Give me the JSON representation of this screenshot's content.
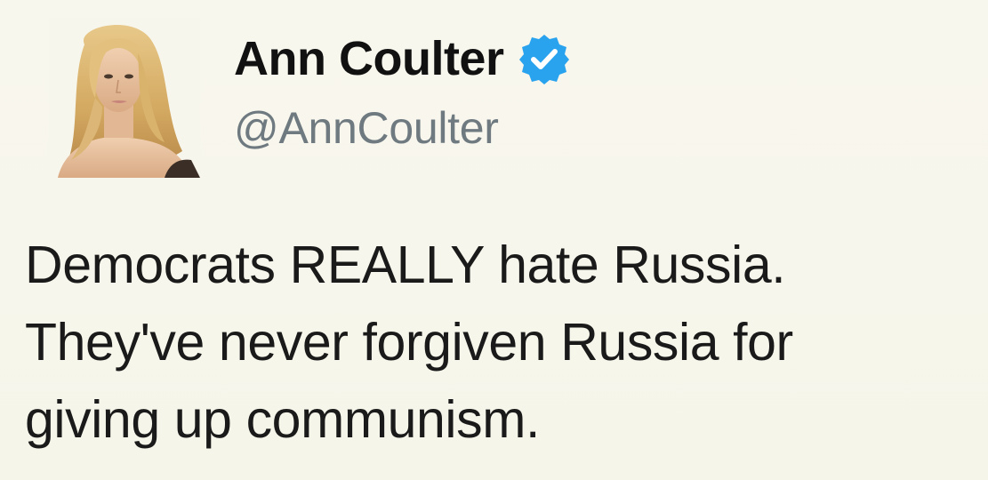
{
  "tweet": {
    "display_name": "Ann Coulter",
    "handle": "@AnnCoulter",
    "verified": true,
    "text_lines": [
      "Democrats REALLY hate Russia.",
      "They've never forgiven Russia for",
      "giving up communism."
    ]
  },
  "icons": {
    "verified": "verified-badge-icon",
    "avatar": "profile-avatar"
  },
  "colors": {
    "background": "#f7f6ec",
    "name": "#111111",
    "handle": "#6f7a80",
    "verified_badge": "#2aa3ef",
    "text": "#1a1a1a"
  }
}
